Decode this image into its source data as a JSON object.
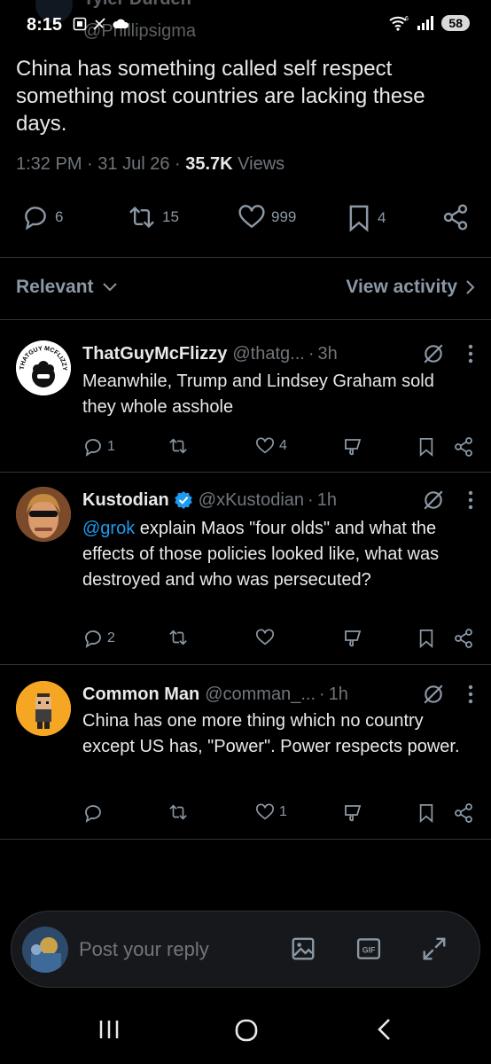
{
  "status_bar": {
    "time": "8:15",
    "battery": "58",
    "signal": "6"
  },
  "ghost_header": {
    "name": "Tyler Durden",
    "handle": "@Phillipsigma"
  },
  "main_tweet": {
    "text": "China has something called self respect something most countries are lacking these days.",
    "time": "1:32 PM",
    "date": "31 Jul 26",
    "views_count": "35.7K",
    "views_label": "Views",
    "replies": "6",
    "reposts": "15",
    "likes": "999",
    "bookmarks": "4"
  },
  "filter": {
    "sort_label": "Relevant",
    "activity_label": "View activity"
  },
  "replies": [
    {
      "name": "ThatGuyMcFlizzy",
      "handle": "@thatg...",
      "time": "3h",
      "verified": false,
      "mention": "",
      "text": "Meanwhile, Trump and Lindsey Graham sold they whole asshole",
      "reply_count": "1",
      "repost_count": "",
      "like_count": "4",
      "avatar_text": "THATGUY MCFLIZZY"
    },
    {
      "name": "Kustodian",
      "handle": "@xKustodian",
      "time": "1h",
      "verified": true,
      "mention": "@grok",
      "text": " explain Maos  \"four olds\" and what the effects of those policies looked like, what was destroyed and who was persecuted?",
      "reply_count": "2",
      "repost_count": "",
      "like_count": ""
    },
    {
      "name": "Common Man",
      "handle": "@comman_...",
      "time": "1h",
      "verified": false,
      "mention": "",
      "text": "China has one more thing which no country except US has, \"Power\". Power respects power.",
      "reply_count": "",
      "repost_count": "",
      "like_count": "1"
    }
  ],
  "composer": {
    "placeholder": "Post your reply",
    "gif_label": "GIF"
  },
  "colors": {
    "background": "#000000",
    "accent": "#1d9bf0",
    "muted": "#71767b",
    "text": "#e7e9ea"
  },
  "icons": [
    "reply-icon",
    "repost-icon",
    "like-icon",
    "bookmark-icon",
    "share-icon",
    "grok-icon",
    "more-icon",
    "downvote-icon",
    "image-icon",
    "gif-icon",
    "expand-icon",
    "verified-icon"
  ]
}
